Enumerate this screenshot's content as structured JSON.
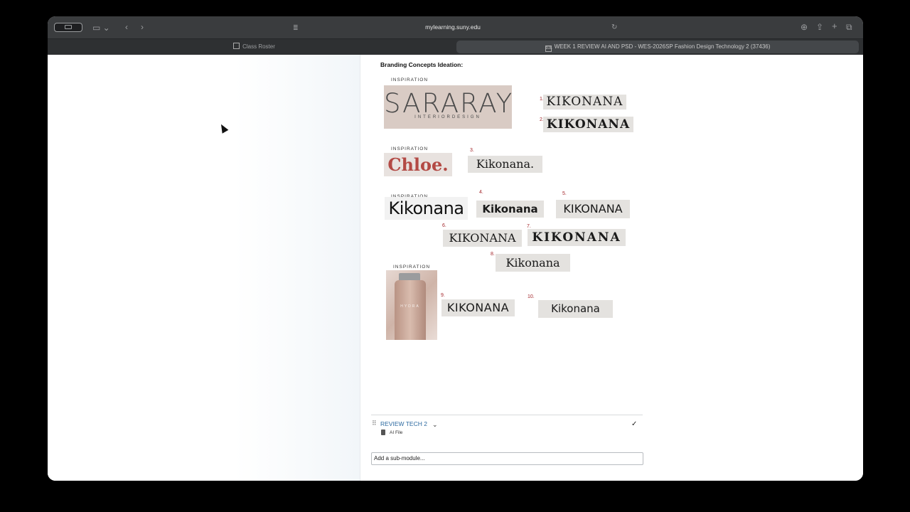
{
  "browser": {
    "url": "mylearning.suny.edu",
    "tabs": [
      {
        "label": "Class Roster"
      },
      {
        "label": "WEEK 1 REVIEW AI AND PSD - WES-2026SP Fashion Design Technology 2 (37436)"
      }
    ]
  },
  "page": {
    "heading": "Branding Concepts Ideation:",
    "inspiration_label": "INSPIRATION",
    "inspiration_1": {
      "main": "SARARAY",
      "sub": "INTERIORDESIGN"
    },
    "inspiration_2": "Chloe.",
    "inspiration_3": "Kikonana",
    "inspiration_4_brand": "HYDRA",
    "options": [
      {
        "num": "1.",
        "text": "KIKONANA"
      },
      {
        "num": "2.",
        "text": "KIKONANA"
      },
      {
        "num": "3.",
        "text": "Kikonana."
      },
      {
        "num": "4.",
        "text": "Kikonana"
      },
      {
        "num": "5.",
        "text": "KIKONANA"
      },
      {
        "num": "6.",
        "text": "KIKONANA"
      },
      {
        "num": "7.",
        "text": "KIKONANA"
      },
      {
        "num": "8.",
        "text": "Kikonana"
      },
      {
        "num": "9.",
        "text": "KIKONANA"
      },
      {
        "num": "10.",
        "text": "Kikonana"
      }
    ],
    "module": {
      "title": "REVIEW TECH 2",
      "file_label": "AI File"
    },
    "submodule_placeholder": "Add a sub-module..."
  },
  "colors": {
    "accent_red": "#a3262a",
    "link_blue": "#2c6aa0",
    "chloe_red": "#b34a45"
  }
}
